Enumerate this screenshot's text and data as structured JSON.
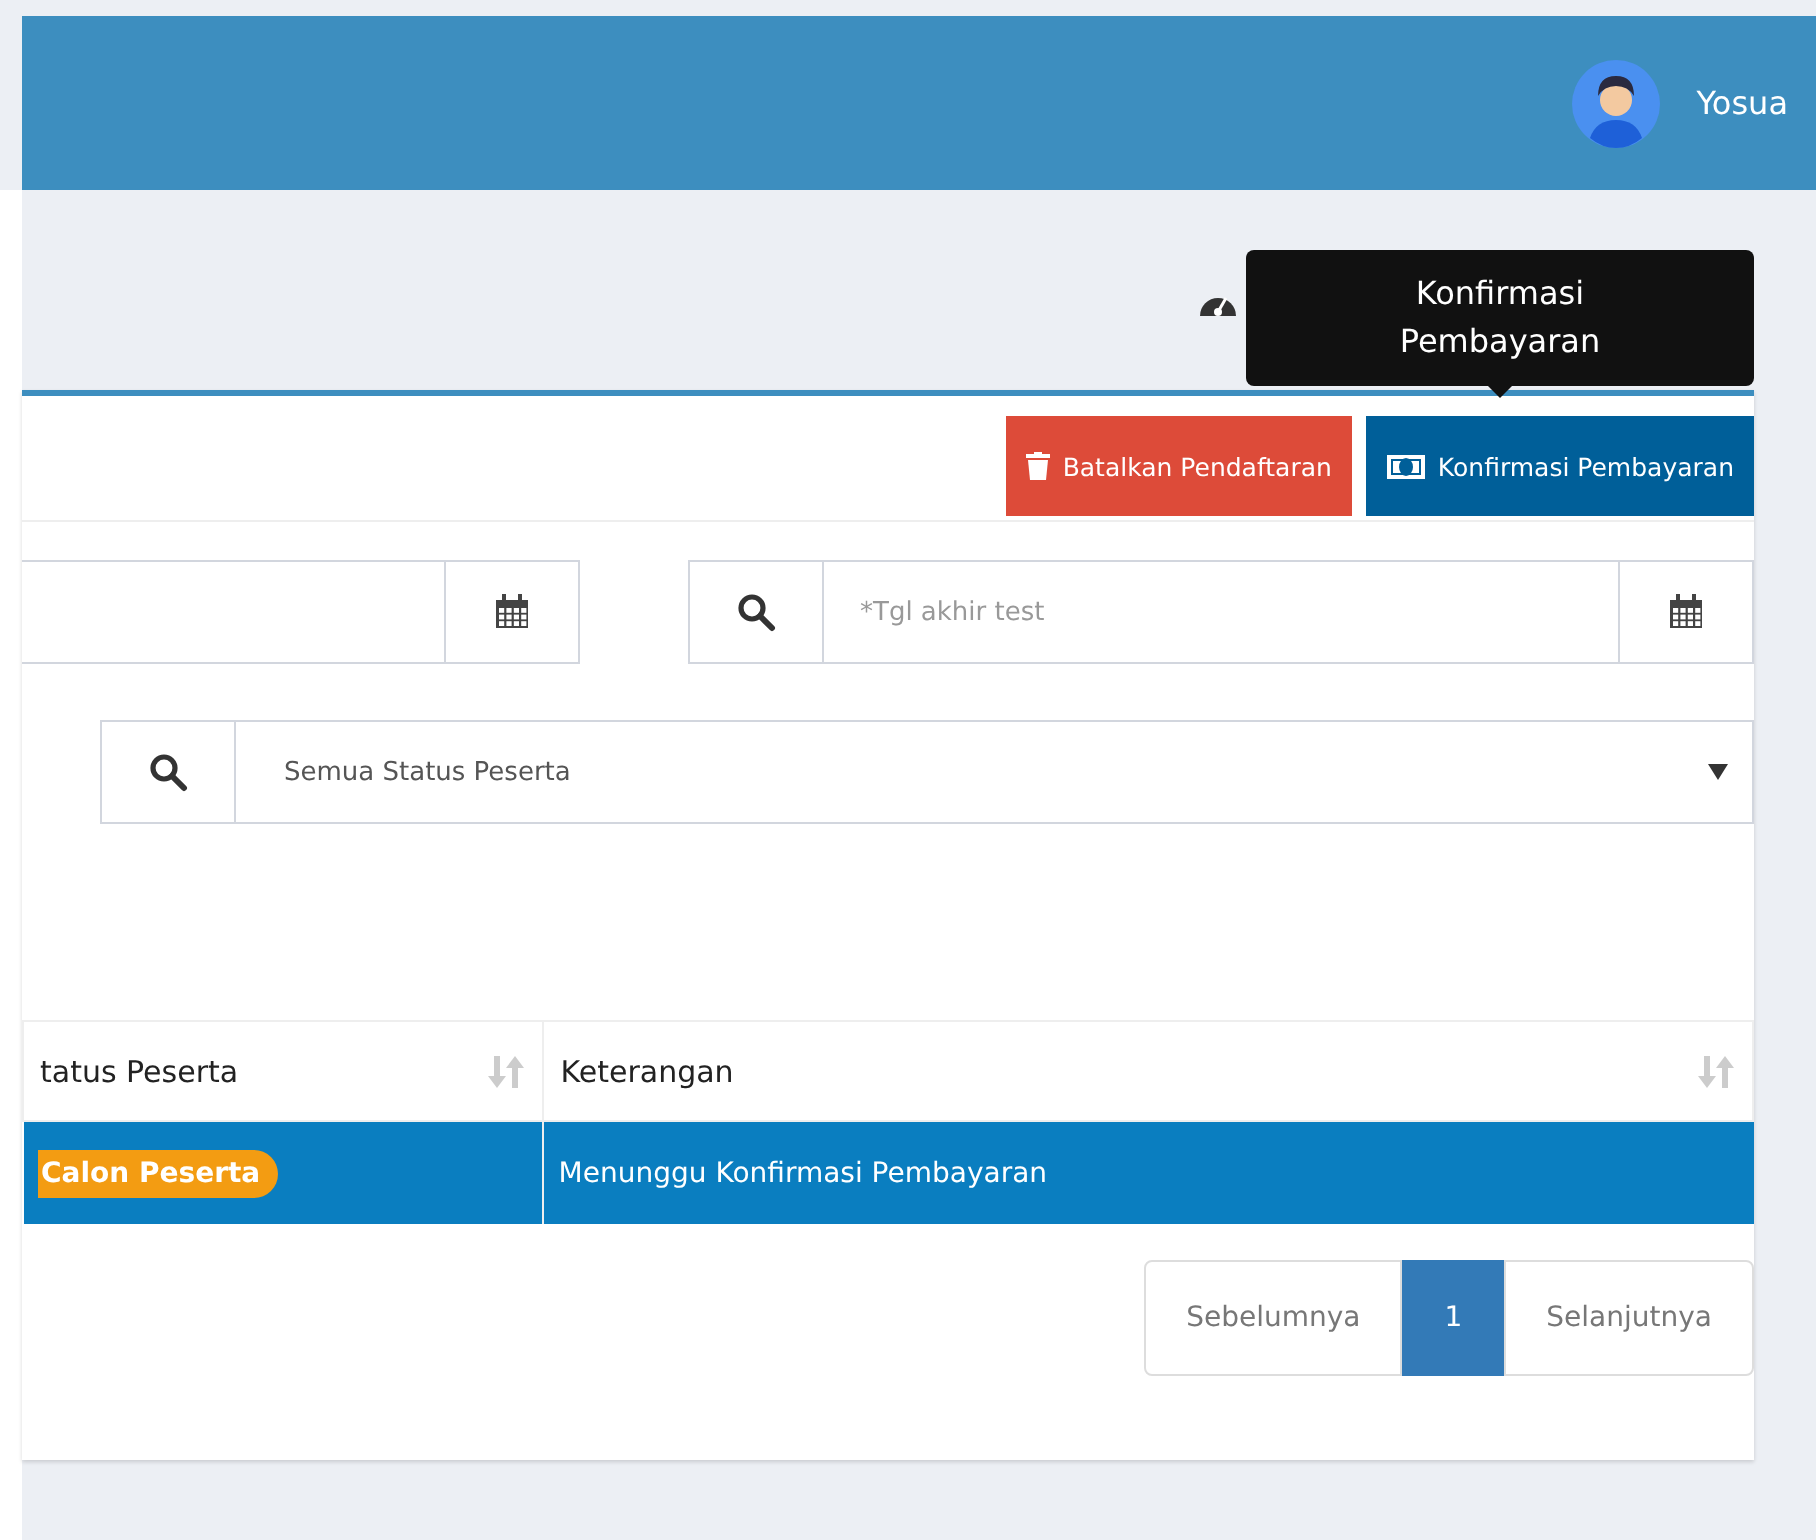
{
  "header": {
    "user_name": "Yosua"
  },
  "tooltip": {
    "text": "Konfirmasi Pembayaran"
  },
  "actions": [
    {
      "label": "Batalkan Pendaftaran",
      "kind": "danger"
    },
    {
      "label": "Konfirmasi Pembayaran",
      "kind": "primary"
    }
  ],
  "filters": {
    "end_date": {
      "placeholder": "*Tgl akhir test"
    },
    "status": {
      "value": "Semua Status Peserta"
    }
  },
  "table": {
    "columns": [
      "tatus Peserta",
      "Keterangan"
    ],
    "rows": [
      {
        "selected": true,
        "status": "Calon Peserta",
        "note": "Menunggu Konfirmasi Pembayaran"
      }
    ]
  },
  "pagination": {
    "previous": "Sebelumnya",
    "next": "Selanjutnya",
    "pages": [
      {
        "label": "1",
        "selected": true
      }
    ]
  }
}
